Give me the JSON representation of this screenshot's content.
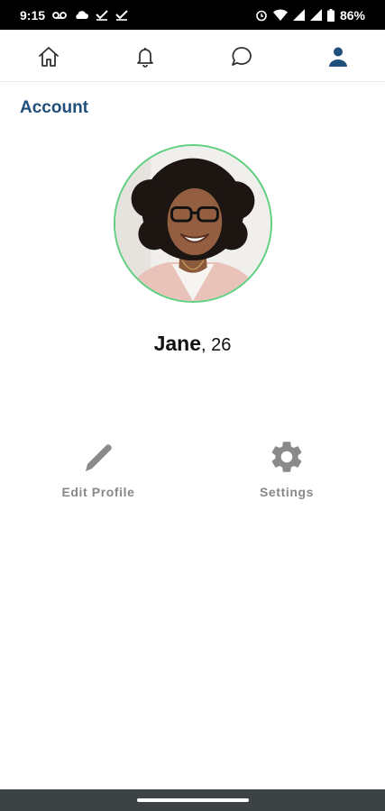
{
  "status_bar": {
    "time": "9:15",
    "battery": "86%",
    "icons": [
      "voicemail-icon",
      "cloud-icon",
      "check-icon",
      "check-icon",
      "alarm-icon",
      "wifi-icon",
      "signal-icon",
      "signal-icon",
      "battery-icon"
    ]
  },
  "nav": {
    "items": [
      {
        "name": "home",
        "icon": "home-icon"
      },
      {
        "name": "notifications",
        "icon": "bell-icon"
      },
      {
        "name": "messages",
        "icon": "chat-bubble-icon"
      },
      {
        "name": "profile",
        "icon": "person-icon",
        "active": true
      }
    ],
    "active_color": "#1f4f7a",
    "inactive_color": "#333333"
  },
  "header": {
    "title": "Account"
  },
  "profile": {
    "name": "Jane",
    "age_suffix": ", 26",
    "avatar_border_color": "#5fcf80"
  },
  "actions": [
    {
      "label": "Edit Profile",
      "icon": "pencil-icon"
    },
    {
      "label": "Settings",
      "icon": "gear-icon"
    }
  ]
}
